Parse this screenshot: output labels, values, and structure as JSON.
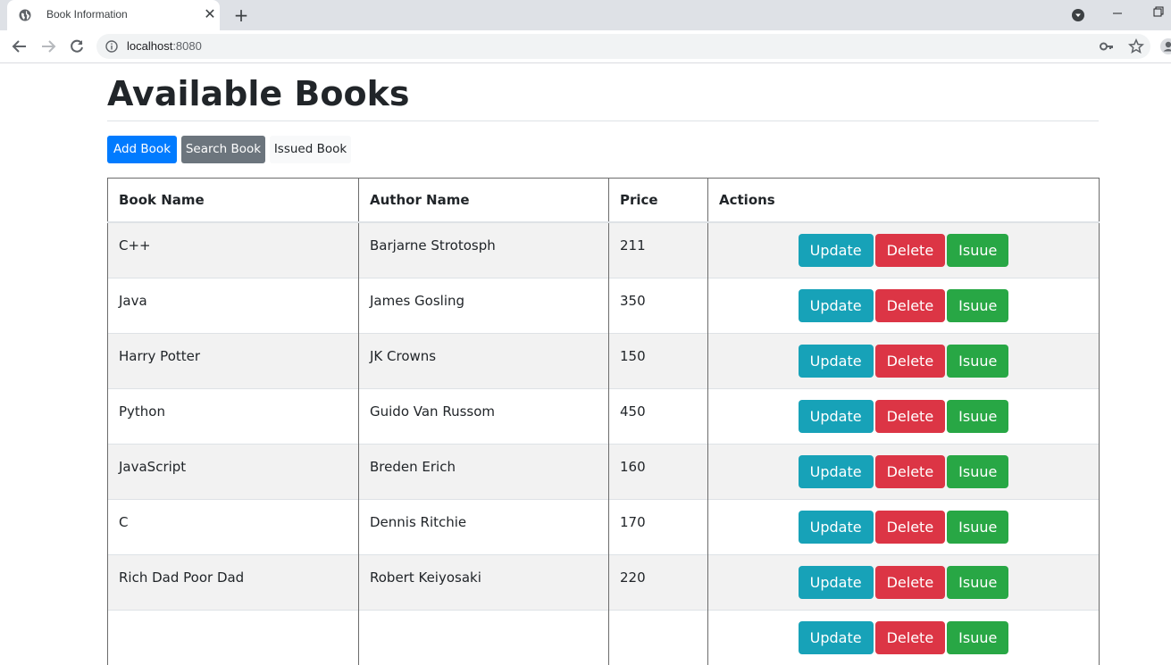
{
  "browser": {
    "tab_title": "Book Information",
    "url_host": "localhost",
    "url_port": ":8080"
  },
  "page": {
    "title": "Available Books",
    "buttons": {
      "add": "Add Book",
      "search": "Search Book",
      "issued": "Issued Book"
    },
    "table": {
      "headers": [
        "Book Name",
        "Author Name",
        "Price",
        "Actions"
      ],
      "action_labels": {
        "update": "Update",
        "delete": "Delete",
        "issue": "Isuue"
      },
      "rows": [
        {
          "name": "C++",
          "author": "Barjarne Strotosph",
          "price": "211"
        },
        {
          "name": "Java",
          "author": "James Gosling",
          "price": "350"
        },
        {
          "name": "Harry Potter",
          "author": "JK Crowns",
          "price": "150"
        },
        {
          "name": "Python",
          "author": "Guido Van Russom",
          "price": "450"
        },
        {
          "name": "JavaScript",
          "author": "Breden Erich",
          "price": "160"
        },
        {
          "name": "C",
          "author": "Dennis Ritchie",
          "price": "170"
        },
        {
          "name": "Rich Dad Poor Dad",
          "author": "Robert Keiyosaki",
          "price": "220"
        },
        {
          "name": "",
          "author": "",
          "price": ""
        }
      ]
    }
  },
  "colors": {
    "primary": "#007bff",
    "secondary": "#6c757d",
    "info": "#17a2b8",
    "danger": "#dc3545",
    "success": "#28a745"
  }
}
